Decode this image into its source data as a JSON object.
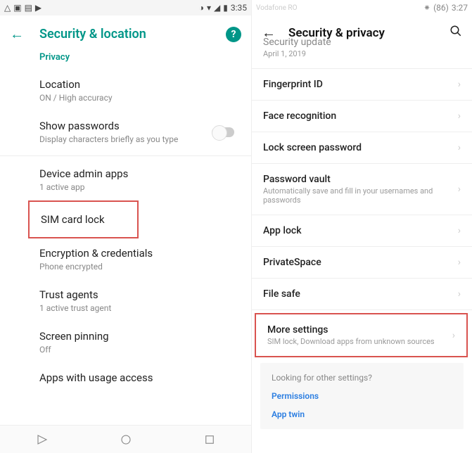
{
  "left": {
    "statusbar": {
      "time": "3:35"
    },
    "header": {
      "title": "Security & location"
    },
    "section": "Privacy",
    "items": {
      "location": {
        "title": "Location",
        "sub": "ON / High accuracy"
      },
      "show_passwords": {
        "title": "Show passwords",
        "sub": "Display characters briefly as you type"
      },
      "device_admin": {
        "title": "Device admin apps",
        "sub": "1 active app"
      },
      "sim_lock": {
        "title": "SIM card lock"
      },
      "encryption": {
        "title": "Encryption & credentials",
        "sub": "Phone encrypted"
      },
      "trust_agents": {
        "title": "Trust agents",
        "sub": "1 active trust agent"
      },
      "screen_pinning": {
        "title": "Screen pinning",
        "sub": "Off"
      },
      "usage_access": {
        "title": "Apps with usage access"
      }
    }
  },
  "right": {
    "statusbar": {
      "carrier": "Vodafone RO",
      "battery": "86",
      "time": "3:27"
    },
    "header": {
      "title": "Security & privacy"
    },
    "items": {
      "security_update": {
        "title": "Security update",
        "sub": "April 1, 2019"
      },
      "fingerprint": {
        "title": "Fingerprint ID"
      },
      "face": {
        "title": "Face recognition"
      },
      "lockscreen": {
        "title": "Lock screen password"
      },
      "vault": {
        "title": "Password vault",
        "sub": "Automatically save and fill in your usernames and passwords"
      },
      "applock": {
        "title": "App lock"
      },
      "privatespace": {
        "title": "PrivateSpace"
      },
      "filesafe": {
        "title": "File safe"
      },
      "more": {
        "title": "More settings",
        "sub": "SIM lock, Download apps from unknown sources"
      }
    },
    "footer": {
      "prompt": "Looking for other settings?",
      "link1": "Permissions",
      "link2": "App twin"
    }
  }
}
